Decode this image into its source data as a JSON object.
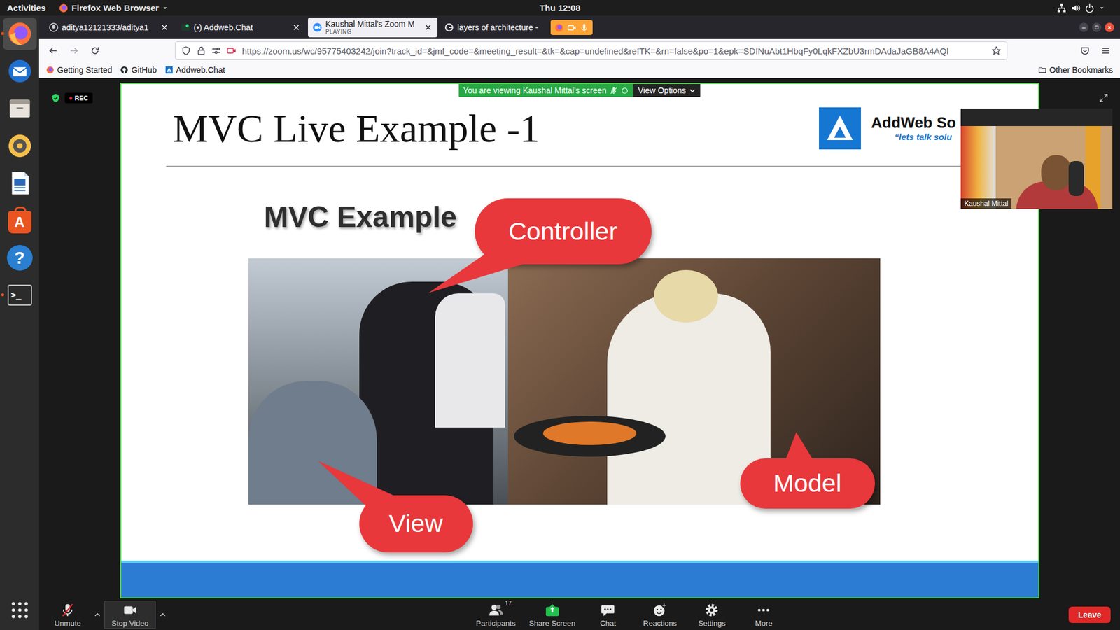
{
  "topbar": {
    "activities": "Activities",
    "app": "Firefox Web Browser",
    "clock": "Thu 12:08"
  },
  "dock": [
    {
      "kind": "firefox",
      "running": true,
      "selected": true
    },
    {
      "kind": "mail",
      "running": false,
      "selected": false
    },
    {
      "kind": "files",
      "running": false,
      "selected": false
    },
    {
      "kind": "music",
      "running": false,
      "selected": false
    },
    {
      "kind": "writer",
      "running": false,
      "selected": false
    },
    {
      "kind": "software",
      "glyph": "A",
      "running": false,
      "selected": false
    },
    {
      "kind": "help",
      "glyph": "?",
      "running": false,
      "selected": false
    },
    {
      "kind": "terminal",
      "glyph": ">_",
      "running": true,
      "selected": false
    }
  ],
  "browser": {
    "tabs": [
      {
        "title": "aditya12121333/aditya1",
        "kind": "github",
        "selected": false,
        "closable": true
      },
      {
        "title": "(•) Addweb.Chat",
        "kind": "chat",
        "selected": false,
        "closable": true
      },
      {
        "title": "Kaushal Mittal's Zoom M",
        "subtitle": "PLAYING",
        "kind": "zoom",
        "selected": true,
        "closable": true
      },
      {
        "title": "layers of architecture -",
        "kind": "google",
        "selected": false,
        "closable": false
      }
    ],
    "sharing": {
      "camera": true,
      "microphone": true
    },
    "url": "https://zoom.us/wc/95775403242/join?track_id=&jmf_code=&meeting_result=&tk=&cap=undefined&refTK=&rn=false&po=1&epk=SDfNuAbt1HbqFy0LqkFXZbU3rmDAdaJaGB8A4AQl",
    "bookmarks": [
      {
        "label": "Getting Started",
        "kind": "firefox"
      },
      {
        "label": "GitHub",
        "kind": "github"
      },
      {
        "label": "Addweb.Chat",
        "kind": "addweb"
      }
    ],
    "other_bookmarks": "Other Bookmarks"
  },
  "zoom": {
    "recording": {
      "label": "REC"
    },
    "banner": {
      "text": "You are viewing Kaushal Mittal's screen",
      "options": "View Options"
    },
    "slide": {
      "title": "MVC Live Example -1",
      "logo": {
        "name": "AddWeb So",
        "tagline": "“lets talk solu"
      },
      "caption": "MVC Example",
      "callouts": [
        {
          "label": "Controller"
        },
        {
          "label": "View"
        },
        {
          "label": "Model"
        }
      ]
    },
    "speaker": {
      "name": "Kaushal Mittal"
    },
    "toolbar": [
      {
        "label": "Unmute",
        "kind": "microphone",
        "menu": true,
        "highlighted": false
      },
      {
        "label": "Stop Video",
        "kind": "video",
        "menu": true,
        "highlighted": true
      },
      {
        "label": "Participants",
        "kind": "participants",
        "count": "17",
        "menu": false,
        "highlighted": false
      },
      {
        "label": "Share Screen",
        "kind": "share",
        "menu": false,
        "highlighted": false
      },
      {
        "label": "Chat",
        "kind": "chat",
        "menu": false,
        "highlighted": false
      },
      {
        "label": "Reactions",
        "kind": "reactions",
        "menu": false,
        "highlighted": false
      },
      {
        "label": "Settings",
        "kind": "settings",
        "menu": false,
        "highlighted": false
      },
      {
        "label": "More",
        "kind": "more",
        "menu": false,
        "highlighted": false
      }
    ],
    "leave": "Leave"
  }
}
